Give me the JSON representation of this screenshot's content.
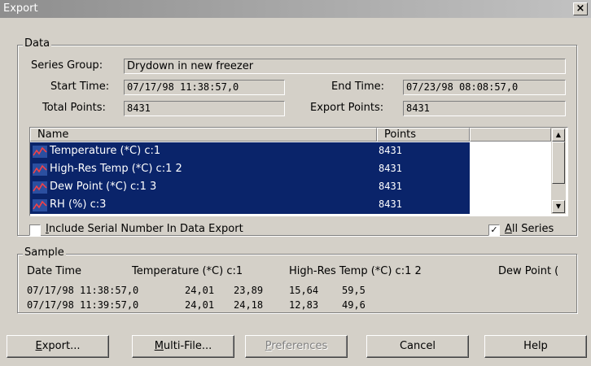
{
  "window": {
    "title": "Export",
    "close_label": "×"
  },
  "data_group": {
    "legend": "Data",
    "series_group_label": "Series Group:",
    "series_group_value": "Drydown in new freezer",
    "start_time_label": "Start Time:",
    "start_time_value": "07/17/98 11:38:57,0",
    "end_time_label": "End Time:",
    "end_time_value": "07/23/98 08:08:57,0",
    "total_points_label": "Total Points:",
    "total_points_value": "8431",
    "export_points_label": "Export Points:",
    "export_points_value": "8431",
    "list": {
      "headers": {
        "name": "Name",
        "points": "Points"
      },
      "rows": [
        {
          "name": "Temperature (*C) c:1",
          "points": "8431",
          "icon": "chart-line-icon"
        },
        {
          "name": "High-Res Temp (*C) c:1 2",
          "points": "8431",
          "icon": "chart-line-icon"
        },
        {
          "name": "Dew Point (*C) c:1 3",
          "points": "8431",
          "icon": "chart-line-icon"
        },
        {
          "name": "RH (%) c:3",
          "points": "8431",
          "icon": "chart-line-icon"
        }
      ]
    },
    "include_serial": {
      "label_u": "I",
      "label_rest": "nclude Serial Number In Data Export",
      "checked": false
    },
    "all_series": {
      "label_u": "A",
      "label_rest": "ll Series",
      "checked": true
    }
  },
  "sample_group": {
    "legend": "Sample",
    "headers": {
      "date_time": "Date Time",
      "temperature": "Temperature (*C) c:1",
      "high_res": "High-Res Temp (*C) c:1 2",
      "dew_point": "Dew Point ("
    },
    "rows": [
      {
        "datetime": "07/17/98 11:38:57,0",
        "v1": "24,01",
        "v2": "23,89",
        "v3": "15,64",
        "v4": "59,5"
      },
      {
        "datetime": "07/17/98 11:39:57,0",
        "v1": "24,01",
        "v2": "24,18",
        "v3": "12,83",
        "v4": "49,6"
      }
    ]
  },
  "buttons": {
    "export": {
      "u": "E",
      "rest": "xport..."
    },
    "multi_file": {
      "u": "M",
      "rest": "ulti-File..."
    },
    "preferences": {
      "u": "P",
      "rest": "references"
    },
    "cancel": "Cancel",
    "help": "Help"
  }
}
